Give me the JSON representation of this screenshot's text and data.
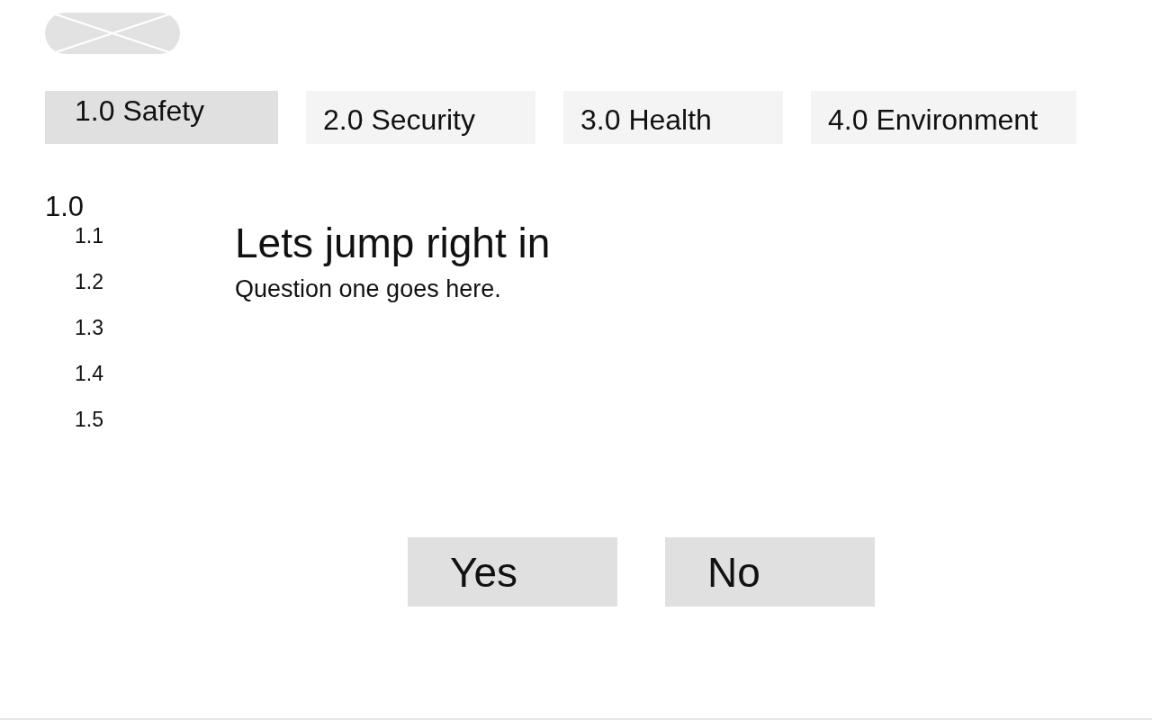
{
  "tabs": [
    {
      "label": "1.0 Safety",
      "selected": true
    },
    {
      "label": "2.0 Security",
      "selected": false
    },
    {
      "label": "3.0 Health",
      "selected": false
    },
    {
      "label": "4.0 Environment",
      "selected": false
    }
  ],
  "outline": {
    "label": "1.0",
    "children": [
      {
        "label": "1.1"
      },
      {
        "label": "1.2"
      },
      {
        "label": "1.3"
      },
      {
        "label": "1.4"
      },
      {
        "label": "1.5"
      }
    ]
  },
  "heading": "Lets jump right in",
  "question": "Question one goes here.",
  "buttons": [
    "Yes",
    "No"
  ]
}
